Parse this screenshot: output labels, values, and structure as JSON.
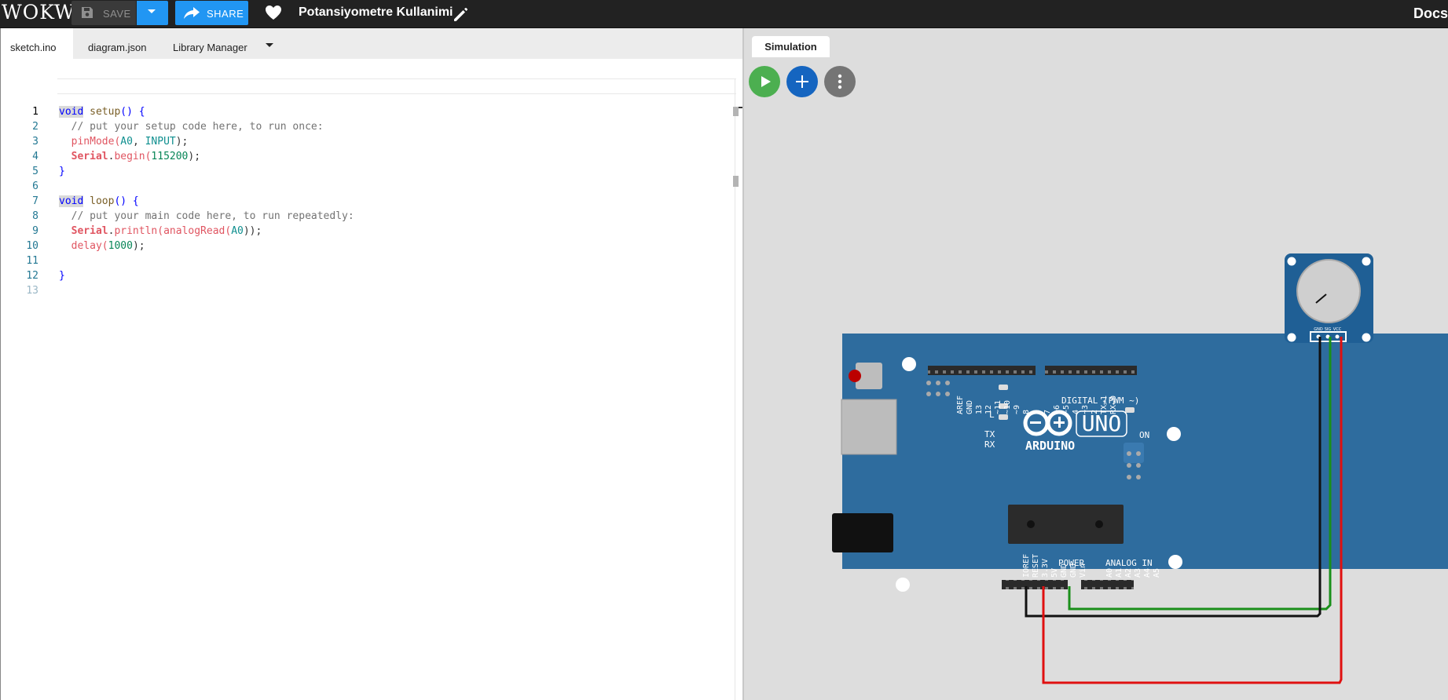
{
  "app": {
    "logo": "WOKWI",
    "project_title": "Potansiyometre Kullanimi",
    "docs_label": "Docs"
  },
  "toolbar": {
    "save_label": "SAVE",
    "share_label": "SHARE"
  },
  "editor": {
    "tabs": [
      {
        "label": "sketch.ino",
        "active": true
      },
      {
        "label": "diagram.json"
      },
      {
        "label": "Library Manager"
      }
    ],
    "line_numbers": [
      "1",
      "2",
      "3",
      "4",
      "5",
      "6",
      "7",
      "8",
      "9",
      "10",
      "11",
      "12",
      "13"
    ]
  },
  "code": {
    "l1": {
      "kw": "void",
      "fn": "setup",
      "rest": "() {"
    },
    "l2": "  // put your setup code here, to run once:",
    "l3": {
      "fn": "pinMode",
      "p1": "(",
      "a1": "A0",
      "sep": ", ",
      "a2": "INPUT",
      "end": ");"
    },
    "l4": {
      "cls": "Serial",
      "dot": ".",
      "fn": "begin",
      "p": "(",
      "num": "115200",
      "end": ");"
    },
    "l5": "}",
    "l7": {
      "kw": "void",
      "fn": "loop",
      "rest": "() {"
    },
    "l8": "  // put your main code here, to run repeatedly:",
    "l9": {
      "cls": "Serial",
      "dot": ".",
      "fn": "println",
      "p": "(",
      "fn2": "analogRead",
      "p2": "(",
      "a": "A0",
      "end": "));"
    },
    "l10": {
      "fn": "delay",
      "p": "(",
      "num": "1000",
      "end": ");"
    },
    "l12": "}"
  },
  "simulation": {
    "tab_label": "Simulation",
    "board": {
      "name": "UNO",
      "brand": "ARDUINO",
      "digital_label": "DIGITAL (PWM ~)",
      "power_label": "POWER",
      "analog_label": "ANALOG IN",
      "on_label": "ON",
      "tx_label": "TX",
      "rx_label": "RX",
      "l_label": "L",
      "digital_pins": [
        "AREF",
        "GND",
        "13",
        "12",
        "~11",
        "~10",
        "~9",
        "8",
        "7",
        "~6",
        "~5",
        "4",
        "~3",
        "2",
        "TX→1",
        "RX←0"
      ],
      "power_pins": [
        "IOREF",
        "RESET",
        "3.3V",
        "5V",
        "GND",
        "GND",
        "Vin"
      ],
      "analog_pins": [
        "A0",
        "A1",
        "A2",
        "A3",
        "A4",
        "A5"
      ]
    },
    "potentiometer": {
      "pins": [
        "GND",
        "SIG",
        "VCC"
      ]
    },
    "wire_colors": {
      "signal": "#1a8f1a",
      "ground": "#111111",
      "power": "#e01010"
    }
  }
}
